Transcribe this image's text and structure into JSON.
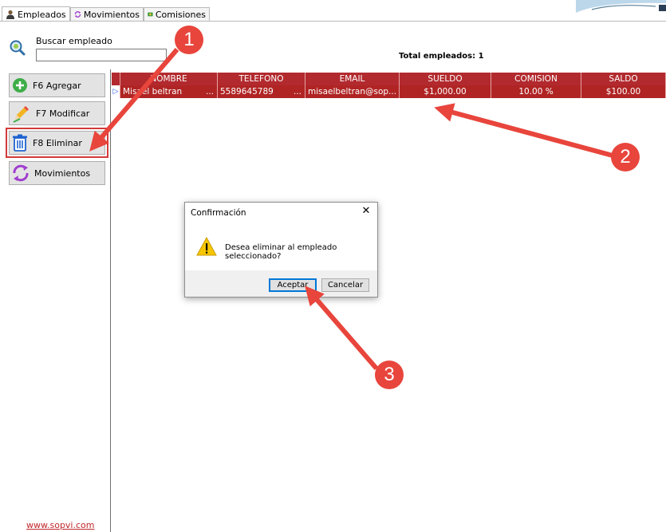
{
  "tabs": [
    {
      "label": "Empleados",
      "icon": "employee-icon",
      "active": true
    },
    {
      "label": "Movimientos",
      "icon": "refresh-icon",
      "active": false
    },
    {
      "label": "Comisiones",
      "icon": "money-icon",
      "active": false
    }
  ],
  "search": {
    "label": "Buscar empleado",
    "value": ""
  },
  "total_label": "Total empleados: 1",
  "sidebar": {
    "buttons": [
      {
        "label": "F6 Agregar",
        "icon": "plus-icon"
      },
      {
        "label": "F7 Modificar",
        "icon": "pencil-icon"
      },
      {
        "label": "F8 Eliminar",
        "icon": "trash-icon"
      },
      {
        "label": "Movimientos",
        "icon": "refresh-icon"
      }
    ],
    "footer_link": "www.sopvi.com"
  },
  "grid": {
    "columns": [
      "NOMBRE",
      "TELEFONO",
      "EMAIL",
      "SUELDO",
      "COMISION",
      "SALDO"
    ],
    "rows": [
      {
        "nombre": "Misael beltran",
        "telefono": "5589645789",
        "email": "misaelbeltran@sop...",
        "sueldo": "$1,000.00",
        "comision": "10.00 %",
        "saldo": "$100.00"
      }
    ]
  },
  "dialog": {
    "title": "Confirmación",
    "message": "Desea eliminar al empleado seleccionado?",
    "accept_label": "Aceptar",
    "cancel_label": "Cancelar",
    "icon": "warning-icon"
  },
  "annotations": {
    "badge1": "1",
    "badge2": "2",
    "badge3": "3",
    "color": "#e8453c"
  },
  "colors": {
    "grid_header": "#b22a2e",
    "grid_row": "#b02424",
    "accent": "#0078d7"
  }
}
